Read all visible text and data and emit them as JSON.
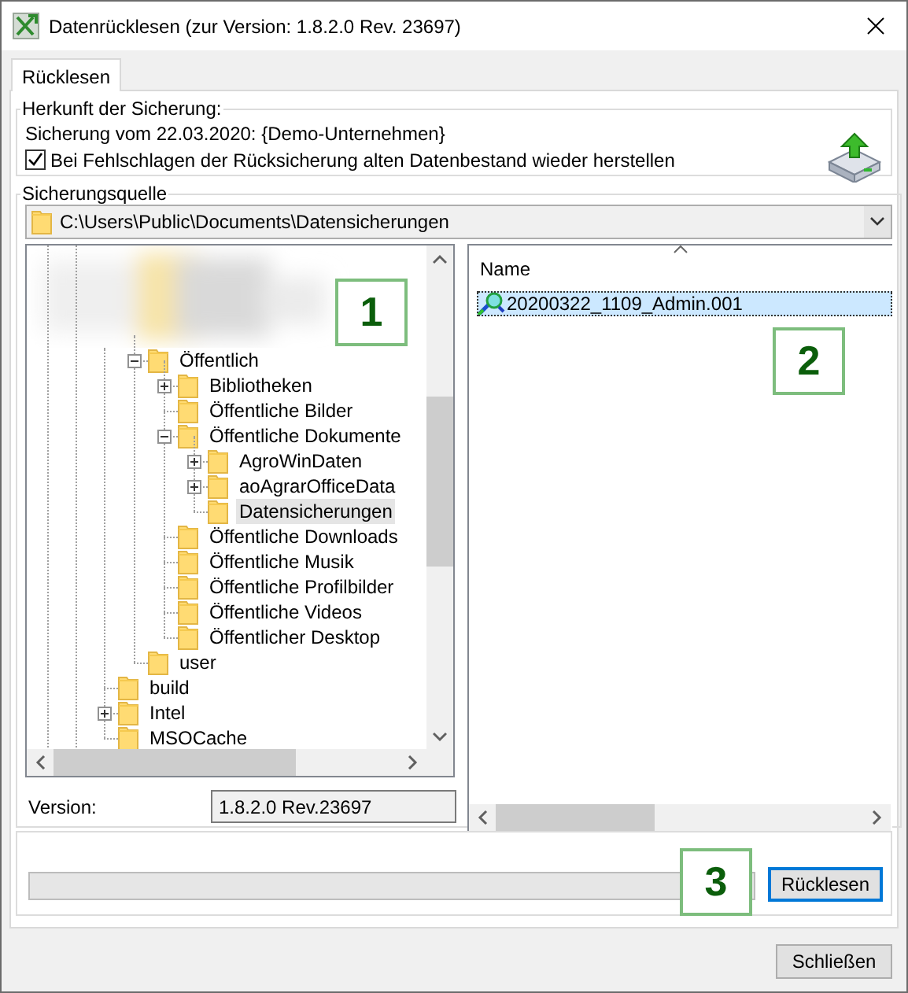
{
  "window": {
    "title": "Datenrücklesen (zur Version: 1.8.2.0 Rev. 23697)"
  },
  "tabs": [
    {
      "label": "Rücklesen",
      "selected": true
    }
  ],
  "origin": {
    "legend": "Herkunft der Sicherung:",
    "info": "Sicherung vom 22.03.2020: {Demo-Unternehmen}",
    "restore_checkbox": {
      "label": "Bei Fehlschlagen der Rücksicherung alten Datenbestand wieder herstellen",
      "checked": true
    }
  },
  "source": {
    "legend": "Sicherungsquelle",
    "path_combo": {
      "value": "C:\\Users\\Public\\Documents\\Datensicherungen"
    },
    "tree": {
      "nodes": [
        {
          "children": [
            {
              "label": "Öffentlich",
              "expanded": true,
              "selected": false,
              "children": [
                {
                  "label": "Bibliotheken",
                  "expanded": false,
                  "selected": false
                },
                {
                  "label": "Öffentliche Bilder",
                  "selected": false
                },
                {
                  "label": "Öffentliche Dokumente",
                  "expanded": true,
                  "selected": false,
                  "children": [
                    {
                      "label": "AgroWinDaten",
                      "expanded": false,
                      "selected": false
                    },
                    {
                      "label": "aoAgrarOfficeData",
                      "expanded": false,
                      "selected": false
                    },
                    {
                      "label": "Datensicherungen",
                      "selected": true
                    }
                  ]
                },
                {
                  "label": "Öffentliche Downloads",
                  "selected": false
                },
                {
                  "label": "Öffentliche Musik",
                  "selected": false
                },
                {
                  "label": "Öffentliche Profilbilder",
                  "selected": false
                },
                {
                  "label": "Öffentliche Videos",
                  "selected": false
                },
                {
                  "label": "Öffentlicher Desktop",
                  "selected": false
                }
              ]
            },
            {
              "label": "user",
              "selected": false
            }
          ]
        },
        {
          "label": "build",
          "selected": false
        },
        {
          "label": "Intel",
          "expanded": false,
          "selected": false
        },
        {
          "label": "MSOCache",
          "selected": false
        }
      ]
    },
    "version": {
      "label": "Version:",
      "value": "1.8.2.0 Rev.23697"
    },
    "file_list": {
      "columns": [
        "Name"
      ],
      "rows": [
        {
          "name": "20200322_1109_Admin.001",
          "selected": true
        }
      ]
    }
  },
  "progress": {
    "level": 0,
    "button": "Rücklesen"
  },
  "close_button": "Schließen",
  "callouts": [
    "1",
    "2",
    "3"
  ]
}
